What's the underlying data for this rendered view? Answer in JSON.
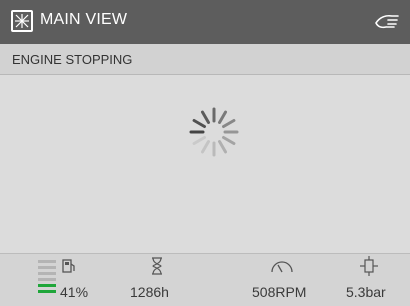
{
  "header": {
    "title": "MAIN VIEW",
    "title_icon": "view-icon",
    "right_icon": "hand-icon"
  },
  "status": {
    "message": "ENGINE STOPPING"
  },
  "main": {
    "indicator": "loading-spinner-icon"
  },
  "footer": {
    "fuel": {
      "icon": "fuel-pump-icon",
      "value": "41%",
      "level_fraction": 0.41,
      "bar_color": "#1fa63a"
    },
    "hours": {
      "icon": "hourglass-icon",
      "value": "1286h"
    },
    "rpm": {
      "icon": "tachometer-icon",
      "value": "508RPM"
    },
    "oil_pressure": {
      "icon": "oil-pressure-icon",
      "value": "5.3bar"
    }
  },
  "colors": {
    "header_bg": "#5d5d5d",
    "screen_bg": "#dcdcdc",
    "text": "#3a3a3a",
    "fuel_level": "#1fa63a"
  }
}
